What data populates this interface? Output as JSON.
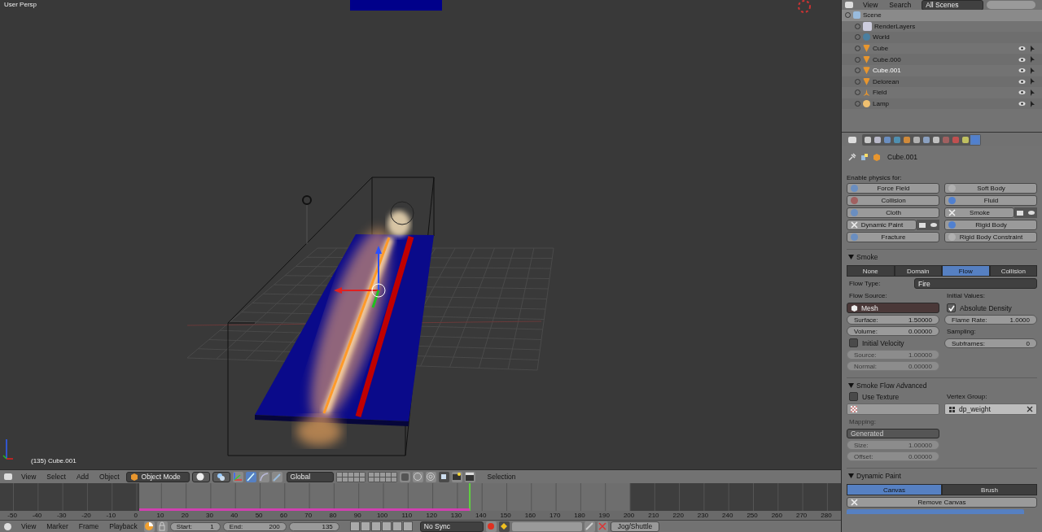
{
  "viewport": {
    "view_name": "User Persp",
    "object_label": "(135) Cube.001"
  },
  "viewport_header": {
    "menus": [
      "View",
      "Select",
      "Add",
      "Object"
    ],
    "mode": "Object Mode",
    "orientation": "Global",
    "layer_label": "Selection"
  },
  "timeline": {
    "ruler": [
      "-50",
      "-40",
      "-30",
      "-20",
      "-10",
      "0",
      "10",
      "20",
      "30",
      "40",
      "50",
      "60",
      "70",
      "80",
      "90",
      "100",
      "110",
      "120",
      "130",
      "140",
      "150",
      "160",
      "170",
      "180",
      "190",
      "200",
      "210",
      "220",
      "230",
      "240",
      "250",
      "260",
      "270",
      "280"
    ]
  },
  "timeline_header": {
    "menus": [
      "View",
      "Marker",
      "Frame",
      "Playback"
    ],
    "start_label": "Start:",
    "start": "1",
    "end_label": "End:",
    "end": "200",
    "current": "135",
    "sync": "No Sync",
    "keying_button": "Jog/Shuttle"
  },
  "outliner": {
    "menus": [
      "View",
      "Search"
    ],
    "scenes": "All Scenes",
    "tree": [
      {
        "name": "Scene",
        "kind": "scene",
        "selected": false,
        "children": [
          {
            "name": "RenderLayers",
            "kind": "layers",
            "selected": false
          },
          {
            "name": "World",
            "kind": "world",
            "selected": false
          },
          {
            "name": "Cube",
            "kind": "mesh",
            "selected": false
          },
          {
            "name": "Cube.000",
            "kind": "mesh",
            "selected": false
          },
          {
            "name": "Cube.001",
            "kind": "mesh",
            "selected": true
          },
          {
            "name": "Delorean",
            "kind": "mesh",
            "selected": false
          },
          {
            "name": "Field",
            "kind": "field",
            "selected": false
          },
          {
            "name": "Lamp",
            "kind": "lamp",
            "selected": false
          }
        ]
      }
    ]
  },
  "properties": {
    "tabs": [
      {
        "selected": false
      },
      {
        "selected": false
      },
      {
        "selected": false
      },
      {
        "selected": false
      },
      {
        "selected": false
      },
      {
        "selected": false
      },
      {
        "selected": false
      },
      {
        "selected": false
      },
      {
        "selected": false
      },
      {
        "selected": false
      },
      {
        "selected": false
      },
      {
        "selected": true
      }
    ],
    "object": "Cube.001",
    "physics_heading": "Enable physics for:",
    "physics": [
      {
        "label": "Force Field",
        "enabled": false
      },
      {
        "label": "Soft Body",
        "enabled": false
      },
      {
        "label": "Collision",
        "enabled": false
      },
      {
        "label": "Fluid",
        "enabled": false
      },
      {
        "label": "Cloth",
        "enabled": false
      },
      {
        "label": "Smoke",
        "enabled": true
      },
      {
        "label": "Dynamic Paint",
        "enabled": true
      },
      {
        "label": "Rigid Body",
        "enabled": false
      },
      {
        "label": "Fracture",
        "enabled": false
      },
      {
        "label": "Rigid Body Constraint",
        "enabled": false
      }
    ],
    "smoke": {
      "title": "Smoke",
      "types": [
        {
          "label": "None",
          "selected": false
        },
        {
          "label": "Domain",
          "selected": false
        },
        {
          "label": "Flow",
          "selected": true
        },
        {
          "label": "Collision",
          "selected": false
        }
      ],
      "flow_type_label": "Flow Type:",
      "flow_type": "Fire",
      "flow_source_label": "Flow Source:",
      "flow_source": "Mesh",
      "left_fields": [
        {
          "label": "Surface:",
          "value": "1.50000",
          "disabled": false
        },
        {
          "label": "Volume:",
          "value": "0.00000",
          "disabled": false
        }
      ],
      "initial_velocity": {
        "label": "Initial Velocity",
        "checked": false
      },
      "velocity_fields": [
        {
          "label": "Source:",
          "value": "1.00000",
          "disabled": true
        },
        {
          "label": "Normal:",
          "value": "0.00000",
          "disabled": true
        }
      ],
      "initial_values_label": "Initial Values:",
      "absolute_density": {
        "label": "Absolute Density",
        "checked": true
      },
      "flame_rate": {
        "label": "Flame Rate:",
        "value": "1.0000",
        "disabled": false
      },
      "sampling_label": "Sampling:",
      "subframes": {
        "label": "Subframes:",
        "value": "0",
        "disabled": false
      }
    },
    "advanced": {
      "title": "Smoke Flow Advanced",
      "use_texture": {
        "label": "Use Texture",
        "checked": false
      },
      "vertex_group_label": "Vertex Group:",
      "vertex_group": "dp_weight",
      "mapping_label": "Mapping:",
      "mapping": "Generated",
      "fields": [
        {
          "label": "Size:",
          "value": "1.00000",
          "disabled": true
        },
        {
          "label": "Offset:",
          "value": "0.00000",
          "disabled": true
        }
      ]
    },
    "dynamic_paint": {
      "title": "Dynamic Paint",
      "types": [
        {
          "label": "Canvas",
          "selected": true
        },
        {
          "label": "Brush",
          "selected": false
        }
      ],
      "remove_button": "Remove Canvas"
    }
  }
}
